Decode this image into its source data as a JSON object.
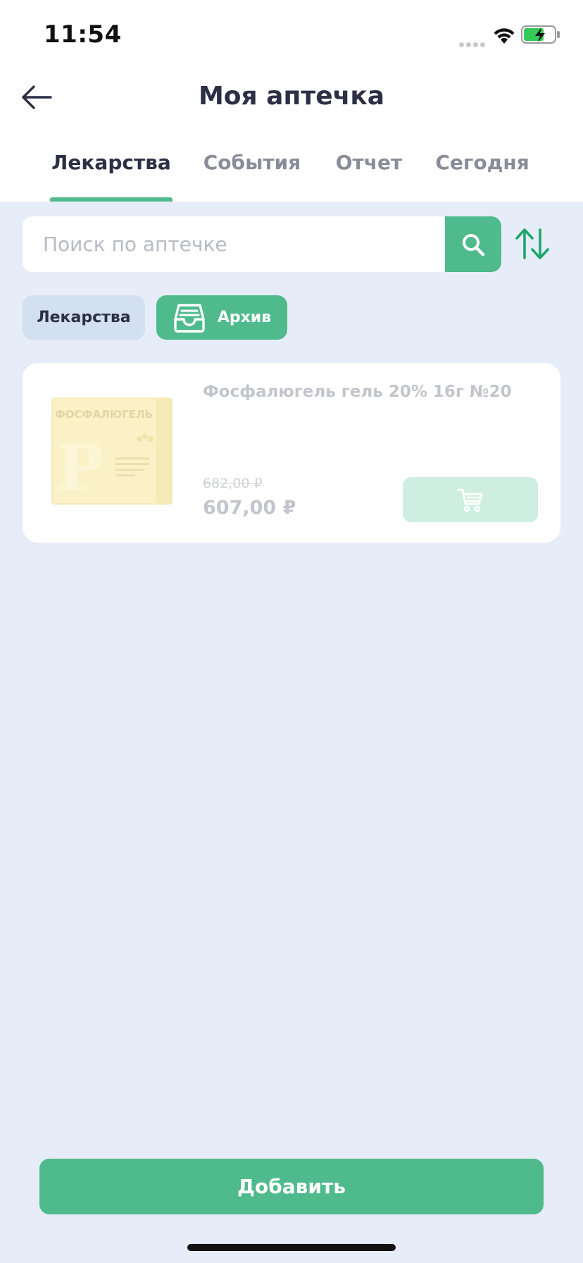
{
  "status_bar": {
    "time": "11:54"
  },
  "header": {
    "title": "Моя аптечка"
  },
  "tabs": [
    {
      "label": "Лекарства",
      "active": true
    },
    {
      "label": "События",
      "active": false
    },
    {
      "label": "Отчет",
      "active": false
    },
    {
      "label": "Сегодня",
      "active": false
    }
  ],
  "search": {
    "placeholder": "Поиск по аптечке",
    "value": ""
  },
  "filters": {
    "medicines_label": "Лекарства",
    "archive_label": "Архив"
  },
  "products": [
    {
      "name": "Фосфалюгель гель 20% 16г №20",
      "old_price": "682,00 ₽",
      "price": "607,00 ₽",
      "image_text": "ФОСФАЛЮГЕЛЬ"
    }
  ],
  "footer": {
    "add_label": "Добавить"
  },
  "colors": {
    "accent": "#4fbb8c",
    "background": "#e6edf8",
    "title_text": "#2d2f45",
    "muted_text": "#8a8c99"
  }
}
